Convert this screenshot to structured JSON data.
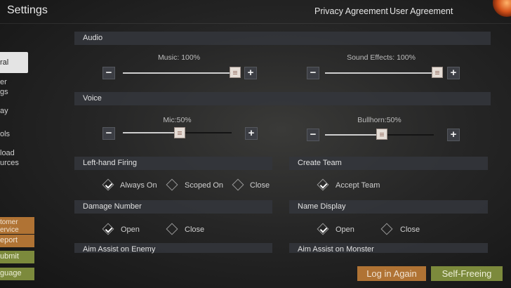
{
  "header": {
    "title": "Settings",
    "privacy": "Privacy Agreement",
    "user": "User Agreement"
  },
  "sidebar": {
    "items": [
      "ral",
      "er\ngs",
      "ay",
      "ols",
      "load\nurces"
    ],
    "active_index": 0,
    "buttons": [
      "tomer\nervice",
      "eport",
      "ubmit",
      "guage"
    ]
  },
  "sections": {
    "audio": "Audio",
    "voice": "Voice",
    "left_hand": "Left-hand Firing",
    "create_team": "Create Team",
    "damage": "Damage Number",
    "name_display": "Name Display",
    "aim_enemy": "Aim Assist on Enemy",
    "aim_monster": "Aim Assist on Monster"
  },
  "sliders": {
    "music": {
      "label": "Music:  100%",
      "value": 1.0
    },
    "sfx": {
      "label": "Sound Effects:  100%",
      "value": 1.0
    },
    "mic": {
      "label": "Mic:50%",
      "value": 0.5
    },
    "bullhorn": {
      "label": "Bullhorn:50%",
      "value": 0.5
    }
  },
  "pm": {
    "minus": "−",
    "plus": "+"
  },
  "options": {
    "left_hand": [
      {
        "label": "Always On",
        "checked": true
      },
      {
        "label": "Scoped On",
        "checked": false
      },
      {
        "label": "Close",
        "checked": false
      }
    ],
    "create_team": [
      {
        "label": "Accept Team",
        "checked": true
      }
    ],
    "damage": [
      {
        "label": "Open",
        "checked": true
      },
      {
        "label": "Close",
        "checked": false
      }
    ],
    "name_display": [
      {
        "label": "Open",
        "checked": true
      },
      {
        "label": "Close",
        "checked": false
      }
    ]
  },
  "footer": {
    "login_again": "Log in Again",
    "self_freeing": "Self-Freeing"
  },
  "colors": {
    "orange_button": "#b07334",
    "olive_button": "#7c8a3c"
  }
}
